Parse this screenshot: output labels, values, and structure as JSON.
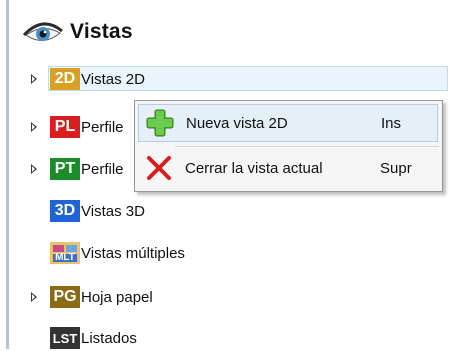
{
  "header": {
    "title": "Vistas",
    "icon": "eye-icon"
  },
  "tree": {
    "items": [
      {
        "badge": "2D",
        "label": "Vistas 2D",
        "badge_color": "#d9a021",
        "expandable": true,
        "selected": true
      },
      {
        "badge": "PL",
        "label": "Perfile",
        "badge_color": "#d81e1e",
        "expandable": true,
        "selected": false
      },
      {
        "badge": "PT",
        "label": "Perfile",
        "badge_color": "#1a8c2a",
        "expandable": true,
        "selected": false
      },
      {
        "badge": "3D",
        "label": "Vistas 3D",
        "badge_color": "#1f63d9",
        "expandable": false,
        "selected": false
      },
      {
        "badge": "MLT",
        "label": "Vistas múltiples",
        "badge_color": "#e9c36a",
        "expandable": false,
        "selected": false
      },
      {
        "badge": "PG",
        "label": "Hoja papel",
        "badge_color": "#8a6b12",
        "expandable": true,
        "selected": false
      },
      {
        "badge": "LST",
        "label": "Listados",
        "badge_color": "#333333",
        "expandable": false,
        "selected": false
      }
    ]
  },
  "context_menu": {
    "items": [
      {
        "label": "Nueva vista 2D",
        "shortcut": "Ins",
        "icon": "plus-icon",
        "icon_color": "#4caf32"
      },
      {
        "label": "Cerrar la vista actual",
        "shortcut": "Supr",
        "icon": "close-icon",
        "icon_color": "#d61e1e"
      }
    ]
  },
  "colors": {
    "selection_bg": "#eaf4fd",
    "selection_border": "#bcdcf6",
    "menu_bg": "#f5f5f5",
    "menu_hover": "#e6eef8"
  }
}
